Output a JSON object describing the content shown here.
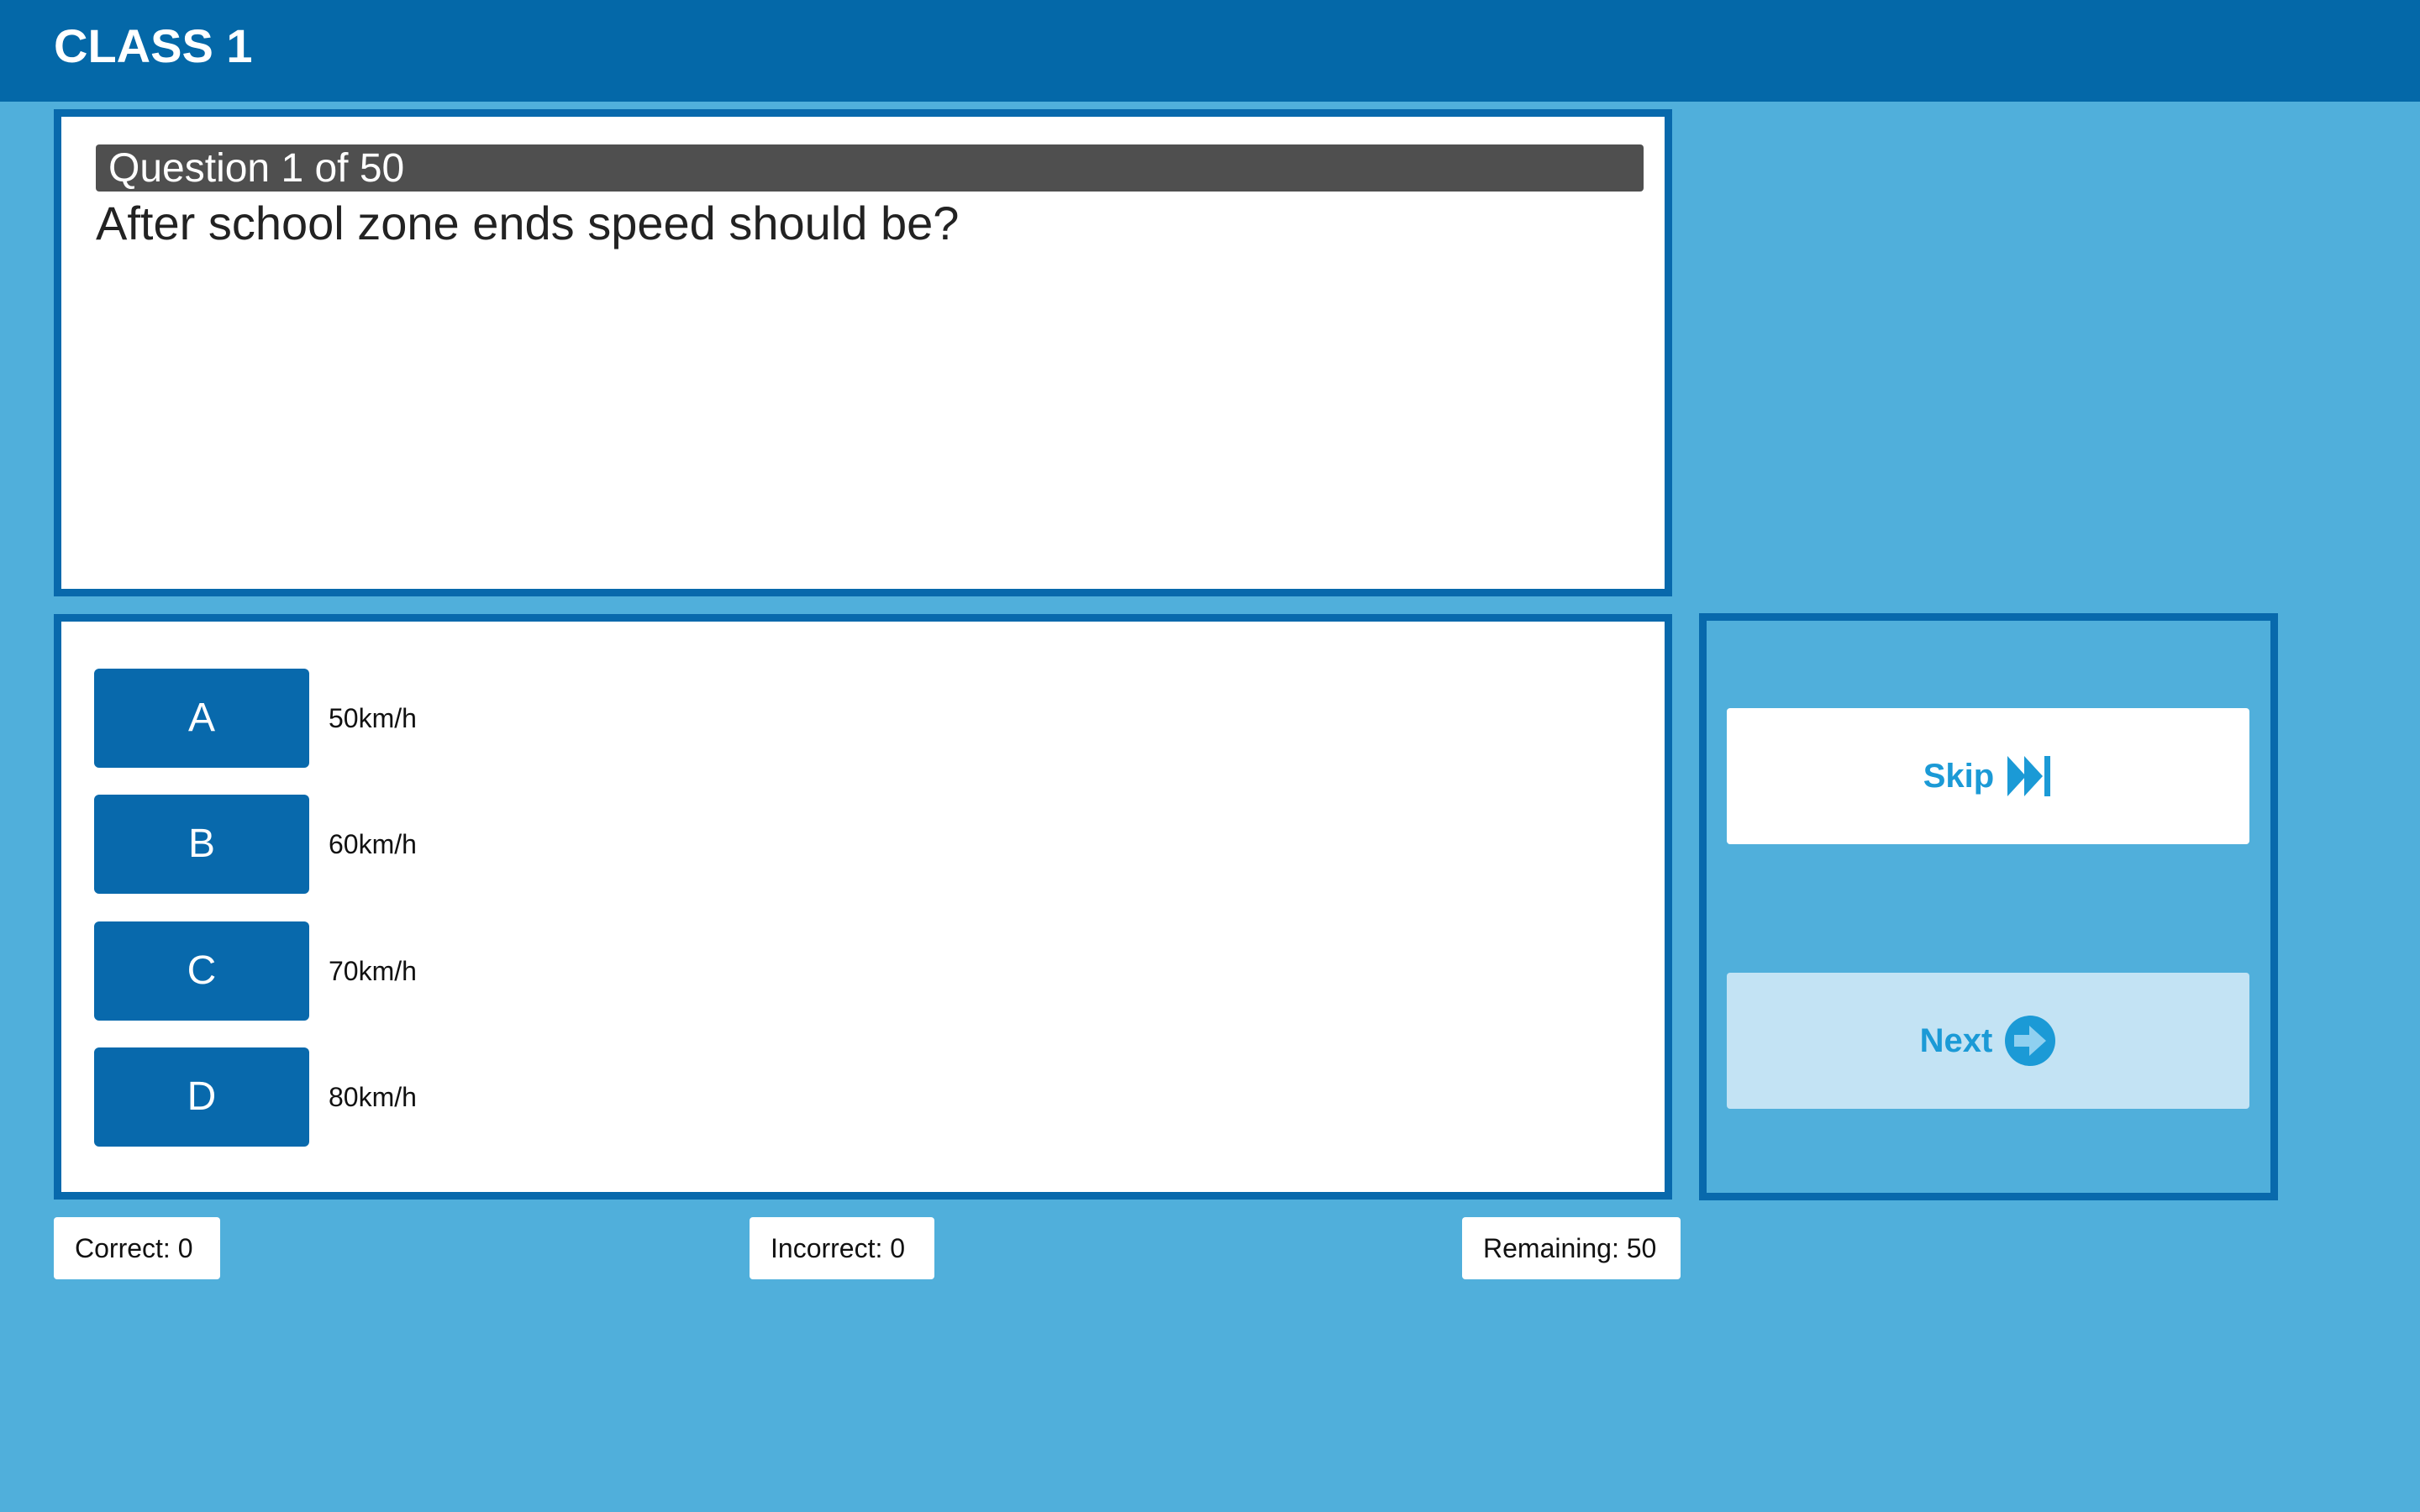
{
  "header": {
    "title": "CLASS 1"
  },
  "question": {
    "progress_label": "Question 1 of 50",
    "text": "After school zone ends speed should be?"
  },
  "answers": [
    {
      "letter": "A",
      "text": "50km/h"
    },
    {
      "letter": "B",
      "text": "60km/h"
    },
    {
      "letter": "C",
      "text": "70km/h"
    },
    {
      "letter": "D",
      "text": "80km/h"
    }
  ],
  "nav": {
    "skip_label": "Skip",
    "skip_icon": "fast-forward-icon",
    "next_label": "Next",
    "next_icon": "arrow-right-circle-icon"
  },
  "stats": {
    "correct": "Correct: 0",
    "incorrect": "Incorrect: 0",
    "remaining": "Remaining: 50"
  },
  "colors": {
    "background": "#50afdb",
    "primary": "#0869ac",
    "header_bar": "#0468a8",
    "question_header": "#4f4f4f",
    "nav_text": "#1b9ad6",
    "next_bg": "#c3e3f4"
  }
}
